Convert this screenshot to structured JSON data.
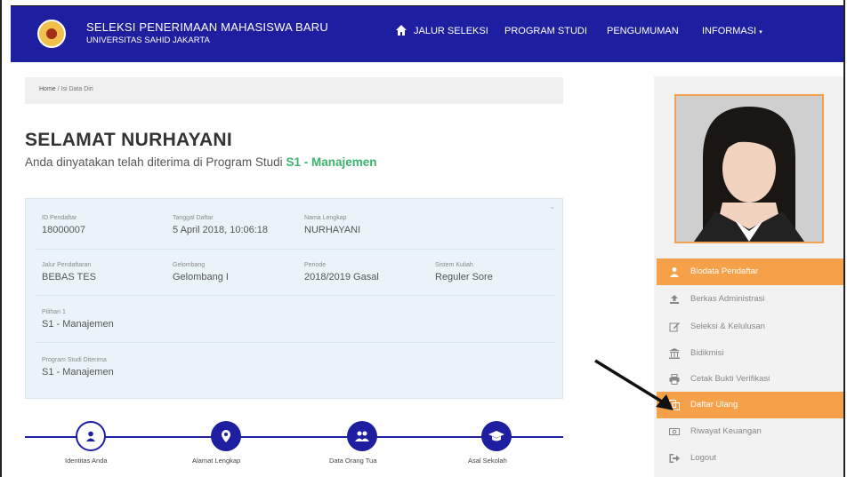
{
  "header": {
    "title": "SELEKSI PENERIMAAN MAHASISWA BARU",
    "subtitle": "UNIVERSITAS SAHID JAKARTA",
    "nav": [
      "JALUR SELEKSI",
      "PROGRAM STUDI",
      "PENGUMUMAN",
      "INFORMASI"
    ],
    "brand_color": "#1e1ea0"
  },
  "breadcrumb": {
    "home": "Home",
    "current": "Isi Data Diri"
  },
  "page": {
    "title": "SELAMAT NURHAYANI",
    "message": "Anda dinyatakan telah diterima di Program Studi",
    "program": "S1 - Manajemen"
  },
  "info": {
    "id_label": "ID Pendaftar",
    "id_value": "18000007",
    "tanggal_label": "Tanggal Daftar",
    "tanggal_value": "5 April 2018, 10:06:18",
    "nama_label": "Nama Lengkap",
    "nama_value": "NURHAYANI",
    "jalur_label": "Jalur Pendaftaran",
    "jalur_value": "BEBAS TES",
    "gelombang_label": "Gelombang",
    "gelombang_value": "Gelombang I",
    "periode_label": "Periode",
    "periode_value": "2018/2019 Gasal",
    "sistem_label": "Sistem Kuliah",
    "sistem_value": "Reguler Sore",
    "pilihan_label": "Pilihan 1",
    "pilihan_value": "S1 - Manajemen",
    "prodi_label": "Program Studi Diterima",
    "prodi_value": "S1 - Manajemen"
  },
  "steps": [
    "Identitas Anda",
    "Alamat Lengkap",
    "Data Orang Tua",
    "Asal Sekolah"
  ],
  "sidebar": {
    "items": [
      {
        "label": "Biodata Pendaftar",
        "icon": "user-icon"
      },
      {
        "label": "Berkas Administrasi",
        "icon": "upload-icon"
      },
      {
        "label": "Seleksi & Kelulusan",
        "icon": "edit-icon"
      },
      {
        "label": "Bidikmisi",
        "icon": "bank-icon"
      },
      {
        "label": "Cetak Bukti Verifikasi",
        "icon": "print-icon"
      },
      {
        "label": "Daftar Ulang",
        "icon": "copy-icon"
      },
      {
        "label": "Riwayat Keuangan",
        "icon": "money-icon"
      },
      {
        "label": "Logout",
        "icon": "sign-out-icon"
      }
    ],
    "accent_color": "#f4a149"
  }
}
